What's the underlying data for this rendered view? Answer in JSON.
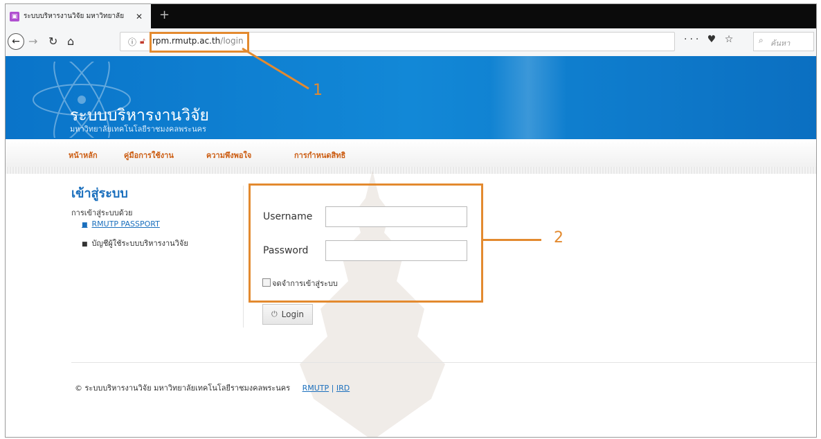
{
  "browser": {
    "tab_title": "ระบบบริหารงานวิจัย มหาวิทยาลัย",
    "tab_close": "✕",
    "new_tab": "+",
    "url_host": "rpm.rmutp.ac.th",
    "url_path": "/login",
    "tools": "··· ♥ ☆",
    "search_placeholder": "ค้นหา"
  },
  "site": {
    "title": "ระบบบริหารงานวิจัย",
    "subtitle": "มหาวิทยาลัยเทคโนโลยีราชมงคลพระนคร"
  },
  "menu": [
    "หน้าหลัก",
    "คู่มือการใช้งาน",
    "ความพึงพอใจ",
    "การกำหนดสิทธิ"
  ],
  "login": {
    "heading": "เข้าสู่ระบบ",
    "login_with": "การเข้าสู่ระบบด้วย",
    "options": [
      "RMUTP PASSPORT",
      "บัญชีผู้ใช้ระบบบริหารงานวิจัย"
    ],
    "username_label": "Username",
    "password_label": "Password",
    "remember_label": "จดจำการเข้าสู่ระบบ",
    "button_label": "Login"
  },
  "annotations": {
    "marker_1": "1",
    "marker_2": "2"
  },
  "footer": {
    "text": "© ระบบบริหารงานวิจัย มหาวิทยาลัยเทคโนโลยีราชมงคลพระนคร",
    "link1": "RMUTP",
    "separator": "|",
    "link2": "IRD"
  },
  "colors": {
    "header_blue": "#0a74c9",
    "menu_orange": "#cc5d12",
    "link_blue": "#1a6fbd",
    "annotation_orange": "#e38a2f"
  }
}
